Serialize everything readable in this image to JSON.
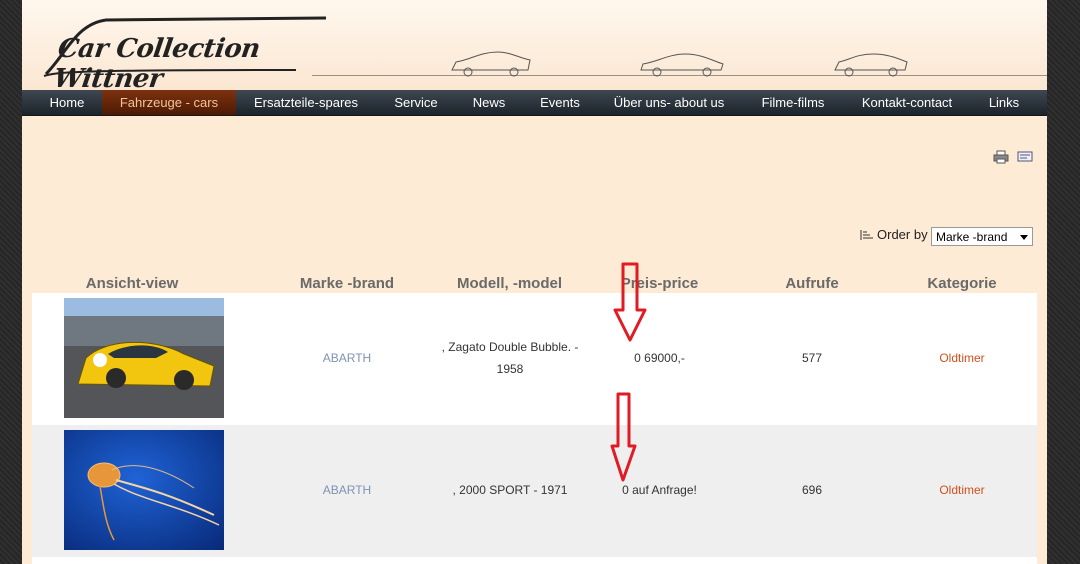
{
  "logo": {
    "text": "Car Collection Wittner"
  },
  "nav": {
    "items": [
      {
        "label": "Home"
      },
      {
        "label": "Fahrzeuge - cars",
        "active": true
      },
      {
        "label": "Ersatzteile-spares"
      },
      {
        "label": "Service"
      },
      {
        "label": "News"
      },
      {
        "label": "Events"
      },
      {
        "label": "Über uns- about us"
      },
      {
        "label": "Filme-films"
      },
      {
        "label": "Kontakt-contact"
      },
      {
        "label": "Links"
      }
    ]
  },
  "toolbar": {
    "print_icon": "printer-icon",
    "email_icon": "email-icon"
  },
  "order": {
    "label": "Order by",
    "selected": "Marke -brand"
  },
  "table": {
    "headers": [
      "Ansicht-view",
      "Marke -brand",
      "Modell, -model",
      "Preis-price",
      "Aufrufe",
      "Kategorie"
    ],
    "rows": [
      {
        "brand": "ABARTH",
        "model_line1": ", Zagato Double Bubble. -",
        "model_line2": "1958",
        "price": "0 69000,-",
        "views": "577",
        "category": "Oldtimer",
        "image": "yellow-race-car"
      },
      {
        "brand": "ABARTH",
        "model_line1": ", 2000 SPORT - 1971",
        "model_line2": "",
        "price": "0 auf Anfrage!",
        "views": "696",
        "category": "Oldtimer",
        "image": "jellyfish"
      }
    ]
  },
  "annotations": {
    "arrow_color": "#e01b24"
  },
  "colors": {
    "accent": "#7d3210",
    "brand_link": "#7e93b4",
    "category_link": "#d2501b",
    "background": "#fdebd5"
  }
}
